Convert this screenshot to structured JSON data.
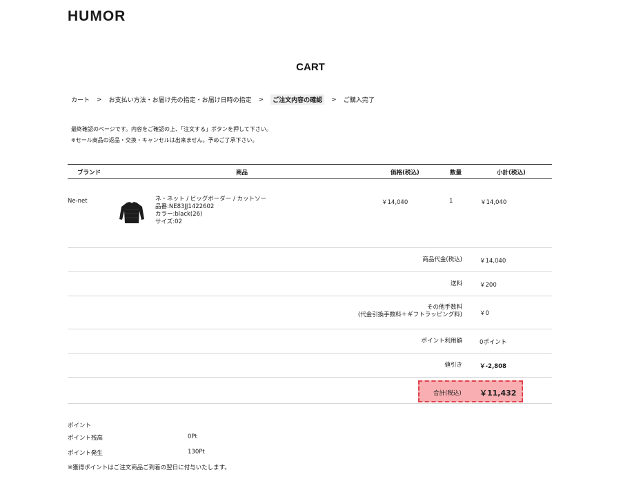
{
  "header": {
    "logo": "HUMOR"
  },
  "page": {
    "title": "CART"
  },
  "steps": [
    {
      "label": "カート",
      "active": false
    },
    {
      "label": "お支払い方法・お届け先の指定・お届け日時の指定",
      "active": false
    },
    {
      "label": "ご注文内容の確認",
      "active": true
    },
    {
      "label": "ご購入完了",
      "active": false
    }
  ],
  "step_separator": ">",
  "notes": [
    "最終確認のページです。内容をご確認の上、「注文する」ボタンを押して下さい。",
    "※セール商品の返品・交換・キャンセルは出来ません。予めご了承下さい。"
  ],
  "table": {
    "headers": {
      "brand": "ブランド",
      "product": "商品",
      "price": "価格(税込)",
      "qty": "数量",
      "subtotal": "小計(税込)"
    },
    "item": {
      "brand": "Ne-net",
      "name": "ネ・ネット / ビッグボーダー / カットソー",
      "sku": "品番:NE83JJ1422602",
      "color": "カラー:black(26)",
      "size": "サイズ:02",
      "price": "￥14,040",
      "qty": "1",
      "subtotal": "￥14,040"
    }
  },
  "summary": {
    "goods_label": "商品代金(税込)",
    "goods_value": "￥14,040",
    "shipping_label": "送料",
    "shipping_value": "￥200",
    "other_fee_label": "その他手数料",
    "other_fee_sub": "(代金引換手数料＋ギフトラッピング料)",
    "other_fee_value": "￥0",
    "points_used_label": "ポイント利用額",
    "points_used_value": "0ポイント",
    "discount_label": "値引き",
    "discount_value": "￥-2,808",
    "total_label": "合計(税込)",
    "total_value": "￥11,432"
  },
  "points": {
    "title": "ポイント",
    "balance_label": "ポイント残高",
    "balance_value": "0Pt",
    "earned_label": "ポイント発生",
    "earned_value": "130Pt",
    "note": "※獲得ポイントはご注文商品ご到着の翌日に付与いたします。"
  },
  "colors": {
    "total_bg": "#f9aeb1",
    "total_border": "#e0404a"
  }
}
